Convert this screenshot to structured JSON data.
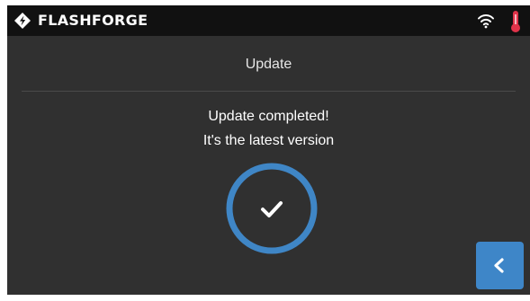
{
  "topbar": {
    "brand": "FLASHFORGE",
    "logo_icon": "flashforge-logo-icon",
    "wifi_icon": "wifi-icon",
    "temperature_icon": "thermometer-icon"
  },
  "page": {
    "title": "Update"
  },
  "status": {
    "line1": "Update completed!",
    "line2": "It's the latest version",
    "icon": "check-icon"
  },
  "navigation": {
    "back_icon": "chevron-left-icon"
  },
  "colors": {
    "screen_background": "#303030",
    "topbar_background": "#111111",
    "accent_blue": "#3e86c8",
    "ring_blue": "#3f86c6",
    "thermometer_red": "#e0334a"
  }
}
